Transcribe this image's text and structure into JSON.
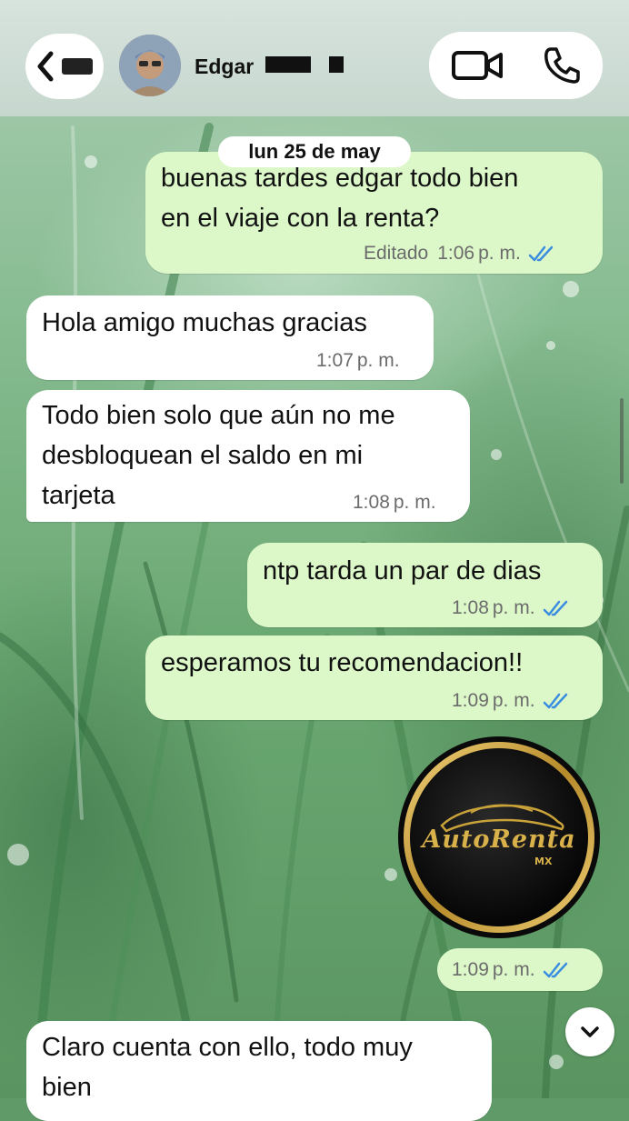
{
  "header": {
    "back_label": "<",
    "contact_name": "Edgar",
    "video_call_icon": "video-camera-icon",
    "voice_call_icon": "phone-icon"
  },
  "date_separator": "lun 25 de may",
  "messages": [
    {
      "direction": "out",
      "text": "buenas tardes edgar todo bien\nen el viaje con la renta?",
      "edited": "Editado",
      "time": "1:06",
      "ampm": "p. m.",
      "status": "read"
    },
    {
      "direction": "in",
      "text": "Hola amigo muchas gracias",
      "time": "1:07",
      "ampm": "p. m."
    },
    {
      "direction": "in",
      "text": "Todo bien solo que aún no me\ndesbloquean el saldo en mi\ntarjeta",
      "time": "1:08",
      "ampm": "p. m."
    },
    {
      "direction": "out",
      "text": "ntp tarda un par de dias",
      "time": "1:08",
      "ampm": "p. m.",
      "status": "read"
    },
    {
      "direction": "out",
      "text": "esperamos tu recomendacion!!",
      "time": "1:09",
      "ampm": "p. m.",
      "status": "read"
    },
    {
      "direction": "out",
      "type": "sticker",
      "sticker_text": "AutoRenta",
      "sticker_subtext": "MX",
      "time": "1:09",
      "ampm": "p. m.",
      "status": "read"
    },
    {
      "direction": "in",
      "text": "Claro cuenta con ello, todo muy\nbien"
    }
  ],
  "colors": {
    "outgoing_bubble": "#dcf8c9",
    "incoming_bubble": "#ffffff",
    "read_ticks": "#3b8de0",
    "sticker_gold": "#c9a23a"
  }
}
